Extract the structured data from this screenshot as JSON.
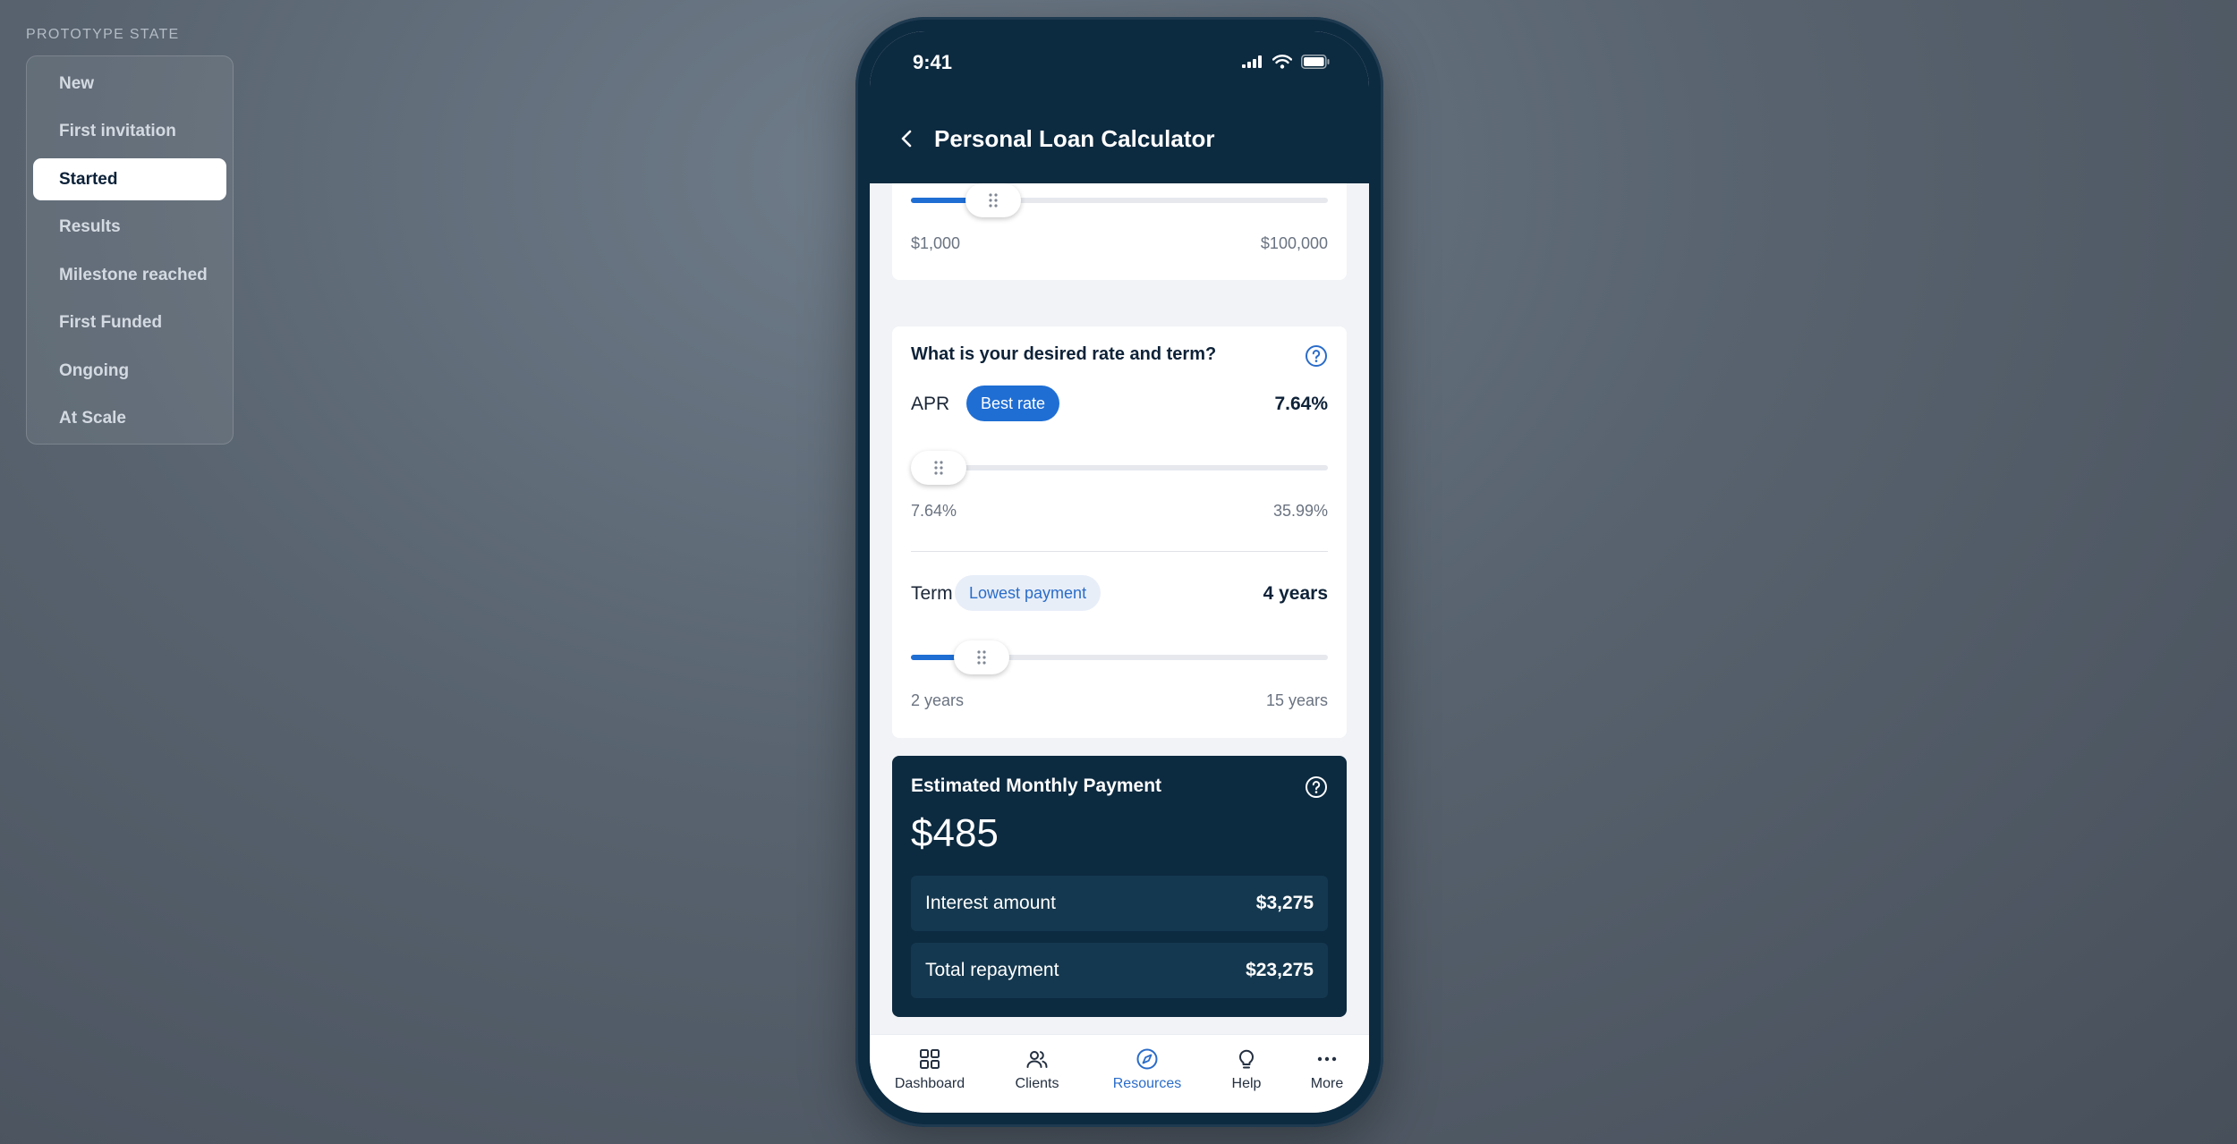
{
  "prototype": {
    "label": "PROTOTYPE STATE",
    "items": [
      {
        "label": "New",
        "active": false
      },
      {
        "label": "First invitation",
        "active": false
      },
      {
        "label": "Started",
        "active": true
      },
      {
        "label": "Results",
        "active": false
      },
      {
        "label": "Milestone reached",
        "active": false
      },
      {
        "label": "First Funded",
        "active": false
      },
      {
        "label": "Ongoing",
        "active": false
      },
      {
        "label": "At Scale",
        "active": false
      }
    ]
  },
  "status": {
    "time": "9:41"
  },
  "header": {
    "title": "Personal Loan Calculator"
  },
  "amount": {
    "min_label": "$1,000",
    "max_label": "$100,000",
    "fraction": 0.15
  },
  "rate_term": {
    "question": "What is your desired rate and term?",
    "apr": {
      "label": "APR",
      "badge": "Best rate",
      "value": "7.64%",
      "min_label": "7.64%",
      "max_label": "35.99%",
      "fraction": 0.0
    },
    "term": {
      "label": "Term",
      "badge": "Lowest payment",
      "value": "4 years",
      "min_label": "2 years",
      "max_label": "15 years",
      "fraction": 0.12
    }
  },
  "estimate": {
    "title": "Estimated Monthly Payment",
    "amount": "$485",
    "interest_label": "Interest amount",
    "interest_value": "$3,275",
    "total_label": "Total repayment",
    "total_value": "$23,275"
  },
  "nav": {
    "items": [
      {
        "label": "Dashboard",
        "icon": "grid-icon",
        "active": false
      },
      {
        "label": "Clients",
        "icon": "users-icon",
        "active": false
      },
      {
        "label": "Resources",
        "icon": "compass-icon",
        "active": true
      },
      {
        "label": "Help",
        "icon": "lightbulb-icon",
        "active": false
      },
      {
        "label": "More",
        "icon": "more-icon",
        "active": false
      }
    ]
  },
  "colors": {
    "navy": "#0c2a40",
    "accent": "#1f6ed4"
  }
}
